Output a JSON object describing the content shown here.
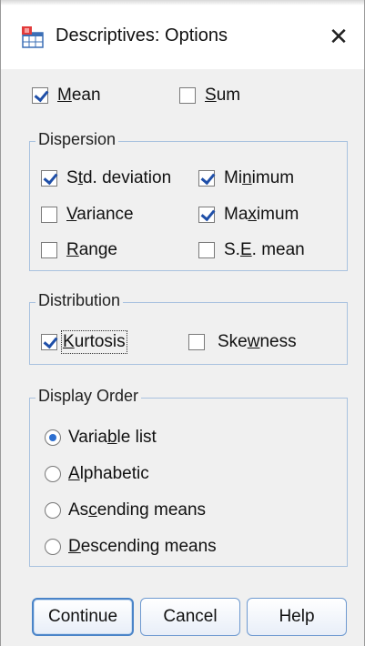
{
  "window": {
    "title": "Descriptives: Options",
    "close_symbol": "✕",
    "icon": "spss-table-icon"
  },
  "top": {
    "mean": {
      "label": "Mean",
      "checked": true
    },
    "sum": {
      "label": "Sum",
      "checked": false
    }
  },
  "dispersion": {
    "legend": "Dispersion",
    "std_deviation": {
      "label": "Std. deviation",
      "checked": true
    },
    "minimum": {
      "label": "Minimum",
      "checked": true
    },
    "variance": {
      "label": "Variance",
      "checked": false
    },
    "maximum": {
      "label": "Maximum",
      "checked": true
    },
    "range": {
      "label": "Range",
      "checked": false
    },
    "se_mean": {
      "label": "S.E. mean",
      "checked": false
    }
  },
  "distribution": {
    "legend": "Distribution",
    "kurtosis": {
      "label": "Kurtosis",
      "checked": true
    },
    "skewness": {
      "label": "Skewness",
      "checked": false
    }
  },
  "display_order": {
    "legend": "Display Order",
    "options": [
      {
        "label": "Variable list",
        "selected": true
      },
      {
        "label": "Alphabetic",
        "selected": false
      },
      {
        "label": "Ascending means",
        "selected": false
      },
      {
        "label": "Descending means",
        "selected": false
      }
    ]
  },
  "buttons": {
    "continue": "Continue",
    "cancel": "Cancel",
    "help": "Help"
  },
  "colors": {
    "check": "#1f4fa8",
    "radio_dot": "#2d6fd0",
    "group_border": "#a9c2df",
    "button_border": "#4a84c8"
  }
}
